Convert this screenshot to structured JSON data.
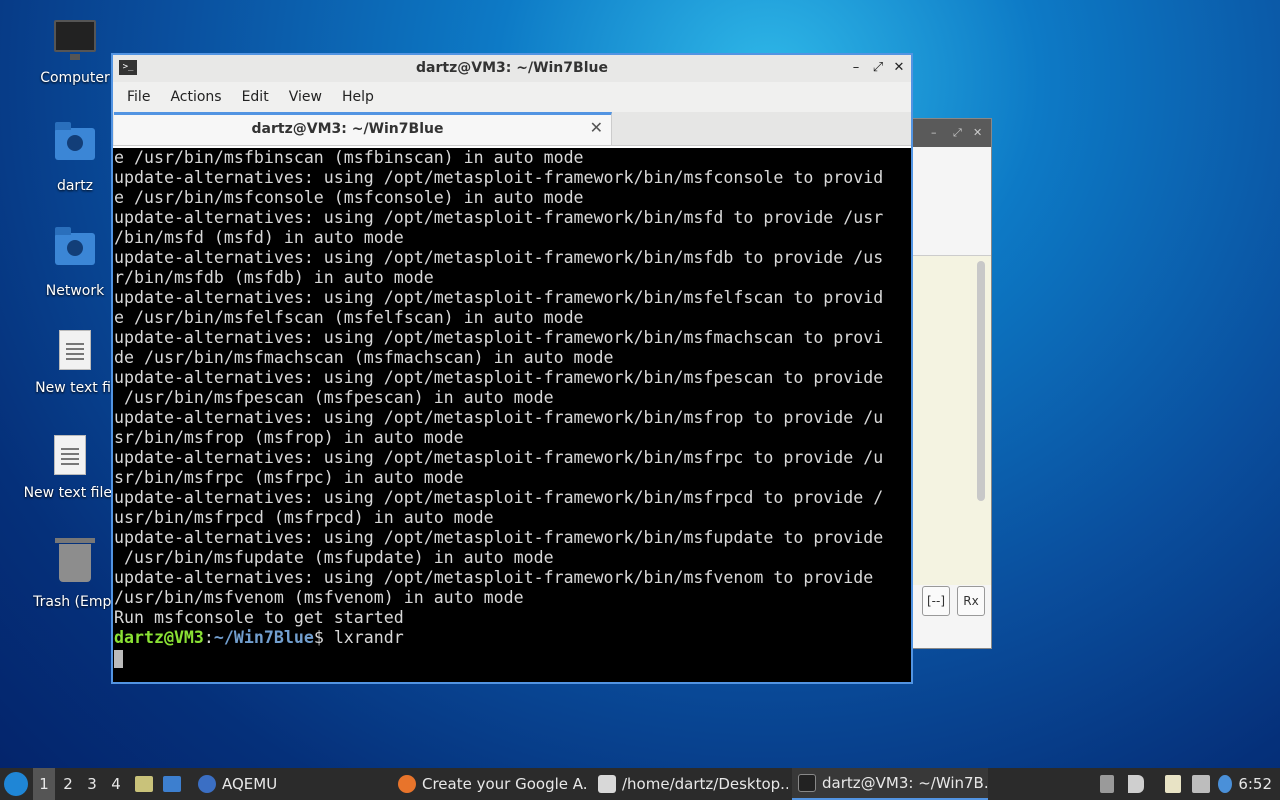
{
  "desktop": {
    "icons": [
      {
        "label": "Computer",
        "icon": "computer-icon"
      },
      {
        "label": "dartz",
        "icon": "home-folder-icon"
      },
      {
        "label": "Network",
        "icon": "network-folder-icon"
      },
      {
        "label": "New text fil",
        "icon": "text-file-icon"
      },
      {
        "label": "New text file.",
        "icon": "text-file-icon"
      },
      {
        "label": "Trash (Empt",
        "icon": "trash-icon"
      }
    ]
  },
  "background_window": {
    "buttons": [
      "[--]",
      "Rx"
    ]
  },
  "terminal_window": {
    "title": "dartz@VM3: ~/Win7Blue",
    "icon_glyph": ">_",
    "controls": {
      "minimize": "–",
      "maximize": "⤢",
      "close": "✕"
    },
    "menu": [
      "File",
      "Actions",
      "Edit",
      "View",
      "Help"
    ],
    "tab": {
      "label": "dartz@VM3: ~/Win7Blue",
      "close": "✕"
    },
    "output_lines": [
      "e /usr/bin/msfbinscan (msfbinscan) in auto mode",
      "update-alternatives: using /opt/metasploit-framework/bin/msfconsole to provid",
      "e /usr/bin/msfconsole (msfconsole) in auto mode",
      "update-alternatives: using /opt/metasploit-framework/bin/msfd to provide /usr",
      "/bin/msfd (msfd) in auto mode",
      "update-alternatives: using /opt/metasploit-framework/bin/msfdb to provide /us",
      "r/bin/msfdb (msfdb) in auto mode",
      "update-alternatives: using /opt/metasploit-framework/bin/msfelfscan to provid",
      "e /usr/bin/msfelfscan (msfelfscan) in auto mode",
      "update-alternatives: using /opt/metasploit-framework/bin/msfmachscan to provi",
      "de /usr/bin/msfmachscan (msfmachscan) in auto mode",
      "update-alternatives: using /opt/metasploit-framework/bin/msfpescan to provide",
      " /usr/bin/msfpescan (msfpescan) in auto mode",
      "update-alternatives: using /opt/metasploit-framework/bin/msfrop to provide /u",
      "sr/bin/msfrop (msfrop) in auto mode",
      "update-alternatives: using /opt/metasploit-framework/bin/msfrpc to provide /u",
      "sr/bin/msfrpc (msfrpc) in auto mode",
      "update-alternatives: using /opt/metasploit-framework/bin/msfrpcd to provide /",
      "usr/bin/msfrpcd (msfrpcd) in auto mode",
      "update-alternatives: using /opt/metasploit-framework/bin/msfupdate to provide",
      " /usr/bin/msfupdate (msfupdate) in auto mode",
      "update-alternatives: using /opt/metasploit-framework/bin/msfvenom to provide",
      "/usr/bin/msfvenom (msfvenom) in auto mode",
      "Run msfconsole to get started"
    ],
    "prompt": {
      "user_host": "dartz@VM3",
      "sep": ":",
      "path": "~/Win7Blue",
      "symbol": "$ ",
      "command": "lxrandr"
    },
    "colors": {
      "background": "#000000",
      "text": "#d8d8d8",
      "prompt_user": "#8ae234",
      "prompt_path": "#729fcf",
      "accent": "#5294e2"
    }
  },
  "taskbar": {
    "workspaces": [
      "1",
      "2",
      "3",
      "4"
    ],
    "active_workspace": "1",
    "tasks": [
      {
        "label": "AQEMU",
        "icon": "aqemu-icon"
      },
      {
        "label": "Create your Google A...",
        "icon": "firefox-icon"
      },
      {
        "label": "/home/dartz/Desktop...",
        "icon": "text-editor-icon"
      },
      {
        "label": "dartz@VM3: ~/Win7B...",
        "icon": "terminal-icon",
        "active": true
      }
    ],
    "clock": "6:52"
  }
}
